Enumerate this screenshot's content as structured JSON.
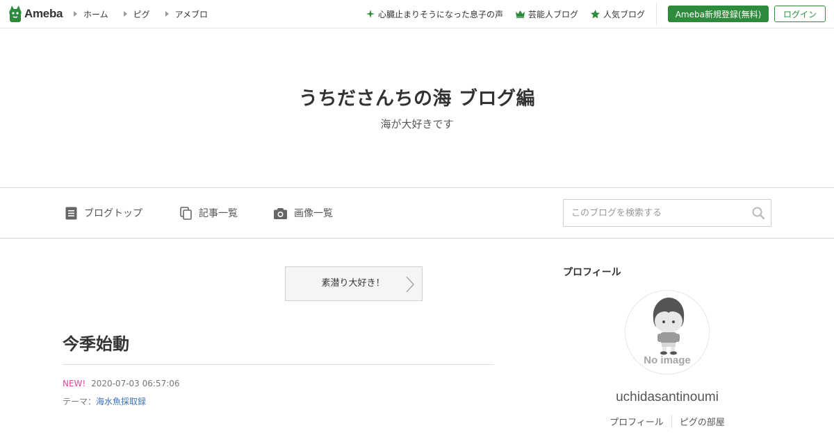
{
  "header": {
    "logo_text": "Ameba",
    "nav": [
      "ホーム",
      "ピグ",
      "アメブロ"
    ],
    "promos": [
      {
        "icon": "sparkle-icon",
        "label": "心臓止まりそうになった息子の声"
      },
      {
        "icon": "crown-icon",
        "label": "芸能人ブログ"
      },
      {
        "icon": "star-icon",
        "label": "人気ブログ"
      }
    ],
    "register_label": "Ameba新規登録(無料)",
    "login_label": "ログイン",
    "brand_color": "#2d8c3c"
  },
  "blog": {
    "title": "うちださんちの海 ブログ編",
    "description": "海が大好きです"
  },
  "blog_nav": {
    "items": [
      {
        "icon": "document-icon",
        "label": "ブログトップ"
      },
      {
        "icon": "copy-icon",
        "label": "記事一覧"
      },
      {
        "icon": "camera-icon",
        "label": "画像一覧"
      }
    ],
    "search_placeholder": "このブログを検索する"
  },
  "pr_banner": {
    "label": "素潜り大好き！"
  },
  "entry": {
    "title": "今季始動",
    "new_badge": "NEW!",
    "datetime": "2020-07-03 06:57:06",
    "theme_prefix": "テーマ：",
    "theme": "海水魚採取録"
  },
  "sidebar": {
    "heading": "プロフィール",
    "avatar_text": "No image",
    "username": "uchidasantinoumi",
    "links": [
      "プロフィール",
      "ピグの部屋"
    ]
  }
}
